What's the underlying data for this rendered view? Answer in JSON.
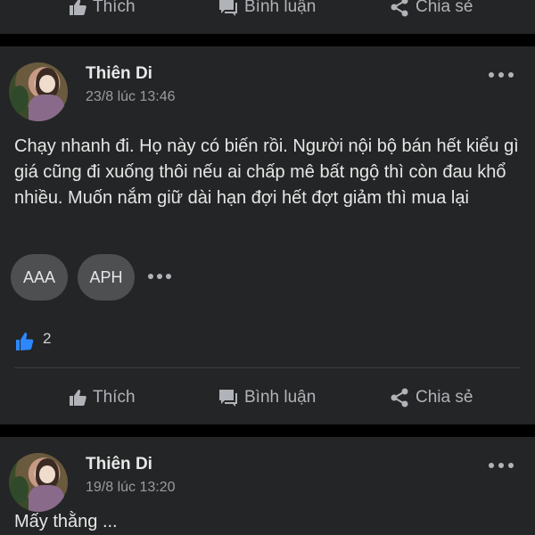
{
  "actions": {
    "like": "Thích",
    "comment": "Bình luận",
    "share": "Chia sẻ"
  },
  "post1": {
    "author": "Thiên Di",
    "time": "23/8 lúc 13:46",
    "text": "Chạy nhanh đi. Họ này có biến rồi. Người nội bộ bán hết kiểu gì giá cũng đi xuống thôi nếu ai chấp mê bất ngộ thì còn đau khổ nhiều. Muốn nắm giữ dài hạn đợi hết đợt giảm thì mua lại",
    "tags": [
      "AAA",
      "APH"
    ],
    "like_count": "2"
  },
  "post2": {
    "author": "Thiên Di",
    "time": "19/8 lúc 13:20",
    "text_cut": "Mấy thằng ..."
  },
  "colors": {
    "background": "#242526",
    "page": "#000000",
    "like_blue": "#2d88ff",
    "muted": "#b0b3b8"
  }
}
